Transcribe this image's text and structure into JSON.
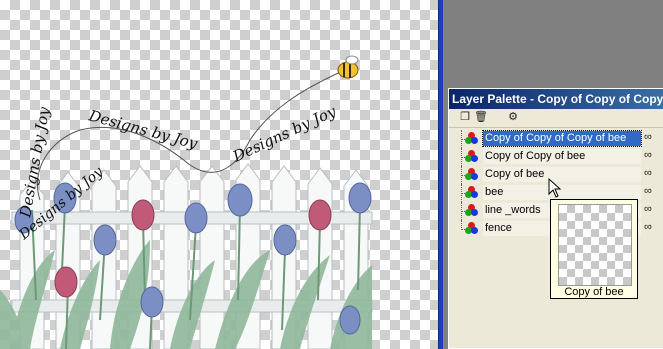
{
  "canvas": {
    "watermark_words": [
      "Designs by Joy",
      "Designs by Joy",
      "Designs by Joy",
      "Designs by Joy"
    ]
  },
  "palette": {
    "title": "Layer Palette - Copy of Copy of Copy of",
    "tools": [
      "new-layer-icon",
      "delete-icon",
      "properties-icon"
    ],
    "layers": [
      {
        "name": "Copy of Copy of Copy of bee",
        "selected": true
      },
      {
        "name": "Copy of Copy of bee",
        "selected": false
      },
      {
        "name": "Copy of bee",
        "selected": false
      },
      {
        "name": "bee",
        "selected": false
      },
      {
        "name": "line _words",
        "selected": false
      },
      {
        "name": "fence",
        "selected": false
      }
    ]
  },
  "tooltip": {
    "label": "Copy of bee"
  }
}
